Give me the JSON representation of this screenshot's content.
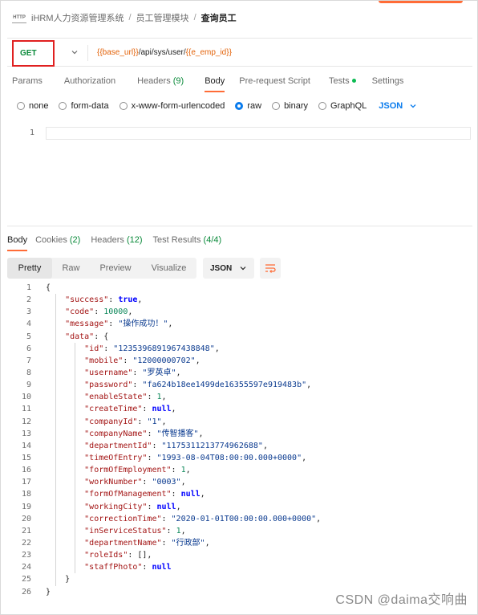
{
  "breadcrumb": {
    "icon": "http-request-icon",
    "items": [
      "iHRM人力资源管理系统",
      "员工管理模块",
      "查询员工"
    ],
    "separator": "/"
  },
  "request": {
    "method": "GET",
    "url_parts": [
      {
        "text": "{{base_url}}",
        "type": "var"
      },
      {
        "text": "/api/sys/user/",
        "type": "plain"
      },
      {
        "text": "{{e_emp_id}}",
        "type": "var"
      }
    ]
  },
  "request_tabs": [
    {
      "label": "Params",
      "count": "",
      "active": false
    },
    {
      "label": "Authorization",
      "count": "",
      "active": false
    },
    {
      "label": "Headers",
      "count": "(9)",
      "active": false
    },
    {
      "label": "Body",
      "count": "",
      "active": true
    },
    {
      "label": "Pre-request Script",
      "count": "",
      "active": false
    },
    {
      "label": "Tests",
      "count": "",
      "dot": true,
      "active": false
    },
    {
      "label": "Settings",
      "count": "",
      "active": false
    }
  ],
  "body_types": [
    {
      "label": "none",
      "checked": false
    },
    {
      "label": "form-data",
      "checked": false
    },
    {
      "label": "x-www-form-urlencoded",
      "checked": false
    },
    {
      "label": "raw",
      "checked": true
    },
    {
      "label": "binary",
      "checked": false
    },
    {
      "label": "GraphQL",
      "checked": false
    }
  ],
  "raw_format": "JSON",
  "editor": {
    "line_number": "1"
  },
  "response_tabs": [
    {
      "label": "Body",
      "count": "",
      "active": true
    },
    {
      "label": "Cookies",
      "count": "(2)",
      "active": false
    },
    {
      "label": "Headers",
      "count": "(12)",
      "active": false
    },
    {
      "label": "Test Results",
      "count": "(4/4)",
      "active": false
    }
  ],
  "format_buttons": [
    {
      "label": "Pretty",
      "active": true
    },
    {
      "label": "Raw",
      "active": false
    },
    {
      "label": "Preview",
      "active": false
    },
    {
      "label": "Visualize",
      "active": false
    }
  ],
  "response_format": "JSON",
  "response_lines": [
    {
      "n": "1",
      "depth": 0,
      "tokens": [
        {
          "t": "{",
          "c": "txt"
        }
      ]
    },
    {
      "n": "2",
      "depth": 1,
      "tokens": [
        {
          "t": "\"success\"",
          "c": "key"
        },
        {
          "t": ": ",
          "c": "txt"
        },
        {
          "t": "true",
          "c": "kw"
        },
        {
          "t": ",",
          "c": "txt"
        }
      ]
    },
    {
      "n": "3",
      "depth": 1,
      "tokens": [
        {
          "t": "\"code\"",
          "c": "key"
        },
        {
          "t": ": ",
          "c": "txt"
        },
        {
          "t": "10000",
          "c": "num"
        },
        {
          "t": ",",
          "c": "txt"
        }
      ]
    },
    {
      "n": "4",
      "depth": 1,
      "tokens": [
        {
          "t": "\"message\"",
          "c": "key"
        },
        {
          "t": ": ",
          "c": "txt"
        },
        {
          "t": "\"操作成功！\"",
          "c": "str"
        },
        {
          "t": ",",
          "c": "txt"
        }
      ]
    },
    {
      "n": "5",
      "depth": 1,
      "tokens": [
        {
          "t": "\"data\"",
          "c": "key"
        },
        {
          "t": ": {",
          "c": "txt"
        }
      ]
    },
    {
      "n": "6",
      "depth": 2,
      "tokens": [
        {
          "t": "\"id\"",
          "c": "key"
        },
        {
          "t": ": ",
          "c": "txt"
        },
        {
          "t": "\"1235396891967438848\"",
          "c": "str"
        },
        {
          "t": ",",
          "c": "txt"
        }
      ]
    },
    {
      "n": "7",
      "depth": 2,
      "tokens": [
        {
          "t": "\"mobile\"",
          "c": "key"
        },
        {
          "t": ": ",
          "c": "txt"
        },
        {
          "t": "\"12000000702\"",
          "c": "str"
        },
        {
          "t": ",",
          "c": "txt"
        }
      ]
    },
    {
      "n": "8",
      "depth": 2,
      "tokens": [
        {
          "t": "\"username\"",
          "c": "key"
        },
        {
          "t": ": ",
          "c": "txt"
        },
        {
          "t": "\"罗英卓\"",
          "c": "str"
        },
        {
          "t": ",",
          "c": "txt"
        }
      ]
    },
    {
      "n": "9",
      "depth": 2,
      "tokens": [
        {
          "t": "\"password\"",
          "c": "key"
        },
        {
          "t": ": ",
          "c": "txt"
        },
        {
          "t": "\"fa624b18ee1499de16355597e919483b\"",
          "c": "str"
        },
        {
          "t": ",",
          "c": "txt"
        }
      ]
    },
    {
      "n": "10",
      "depth": 2,
      "tokens": [
        {
          "t": "\"enableState\"",
          "c": "key"
        },
        {
          "t": ": ",
          "c": "txt"
        },
        {
          "t": "1",
          "c": "num"
        },
        {
          "t": ",",
          "c": "txt"
        }
      ]
    },
    {
      "n": "11",
      "depth": 2,
      "tokens": [
        {
          "t": "\"createTime\"",
          "c": "key"
        },
        {
          "t": ": ",
          "c": "txt"
        },
        {
          "t": "null",
          "c": "kw"
        },
        {
          "t": ",",
          "c": "txt"
        }
      ]
    },
    {
      "n": "12",
      "depth": 2,
      "tokens": [
        {
          "t": "\"companyId\"",
          "c": "key"
        },
        {
          "t": ": ",
          "c": "txt"
        },
        {
          "t": "\"1\"",
          "c": "str"
        },
        {
          "t": ",",
          "c": "txt"
        }
      ]
    },
    {
      "n": "13",
      "depth": 2,
      "tokens": [
        {
          "t": "\"companyName\"",
          "c": "key"
        },
        {
          "t": ": ",
          "c": "txt"
        },
        {
          "t": "\"传智播客\"",
          "c": "str"
        },
        {
          "t": ",",
          "c": "txt"
        }
      ]
    },
    {
      "n": "14",
      "depth": 2,
      "tokens": [
        {
          "t": "\"departmentId\"",
          "c": "key"
        },
        {
          "t": ": ",
          "c": "txt"
        },
        {
          "t": "\"1175311213774962688\"",
          "c": "str"
        },
        {
          "t": ",",
          "c": "txt"
        }
      ]
    },
    {
      "n": "15",
      "depth": 2,
      "tokens": [
        {
          "t": "\"timeOfEntry\"",
          "c": "key"
        },
        {
          "t": ": ",
          "c": "txt"
        },
        {
          "t": "\"1993-08-04T08:00:00.000+0000\"",
          "c": "str"
        },
        {
          "t": ",",
          "c": "txt"
        }
      ]
    },
    {
      "n": "16",
      "depth": 2,
      "tokens": [
        {
          "t": "\"formOfEmployment\"",
          "c": "key"
        },
        {
          "t": ": ",
          "c": "txt"
        },
        {
          "t": "1",
          "c": "num"
        },
        {
          "t": ",",
          "c": "txt"
        }
      ]
    },
    {
      "n": "17",
      "depth": 2,
      "tokens": [
        {
          "t": "\"workNumber\"",
          "c": "key"
        },
        {
          "t": ": ",
          "c": "txt"
        },
        {
          "t": "\"0003\"",
          "c": "str"
        },
        {
          "t": ",",
          "c": "txt"
        }
      ]
    },
    {
      "n": "18",
      "depth": 2,
      "tokens": [
        {
          "t": "\"formOfManagement\"",
          "c": "key"
        },
        {
          "t": ": ",
          "c": "txt"
        },
        {
          "t": "null",
          "c": "kw"
        },
        {
          "t": ",",
          "c": "txt"
        }
      ]
    },
    {
      "n": "19",
      "depth": 2,
      "tokens": [
        {
          "t": "\"workingCity\"",
          "c": "key"
        },
        {
          "t": ": ",
          "c": "txt"
        },
        {
          "t": "null",
          "c": "kw"
        },
        {
          "t": ",",
          "c": "txt"
        }
      ]
    },
    {
      "n": "20",
      "depth": 2,
      "tokens": [
        {
          "t": "\"correctionTime\"",
          "c": "key"
        },
        {
          "t": ": ",
          "c": "txt"
        },
        {
          "t": "\"2020-01-01T00:00:00.000+0000\"",
          "c": "str"
        },
        {
          "t": ",",
          "c": "txt"
        }
      ]
    },
    {
      "n": "21",
      "depth": 2,
      "tokens": [
        {
          "t": "\"inServiceStatus\"",
          "c": "key"
        },
        {
          "t": ": ",
          "c": "txt"
        },
        {
          "t": "1",
          "c": "num"
        },
        {
          "t": ",",
          "c": "txt"
        }
      ]
    },
    {
      "n": "22",
      "depth": 2,
      "tokens": [
        {
          "t": "\"departmentName\"",
          "c": "key"
        },
        {
          "t": ": ",
          "c": "txt"
        },
        {
          "t": "\"行政部\"",
          "c": "str"
        },
        {
          "t": ",",
          "c": "txt"
        }
      ]
    },
    {
      "n": "23",
      "depth": 2,
      "tokens": [
        {
          "t": "\"roleIds\"",
          "c": "key"
        },
        {
          "t": ": [],",
          "c": "txt"
        }
      ]
    },
    {
      "n": "24",
      "depth": 2,
      "tokens": [
        {
          "t": "\"staffPhoto\"",
          "c": "key"
        },
        {
          "t": ": ",
          "c": "txt"
        },
        {
          "t": "null",
          "c": "kw"
        }
      ]
    },
    {
      "n": "25",
      "depth": 1,
      "tokens": [
        {
          "t": "}",
          "c": "txt"
        }
      ]
    },
    {
      "n": "26",
      "depth": 0,
      "tokens": [
        {
          "t": "}",
          "c": "txt"
        }
      ]
    }
  ],
  "watermark": "CSDN @daima交响曲"
}
